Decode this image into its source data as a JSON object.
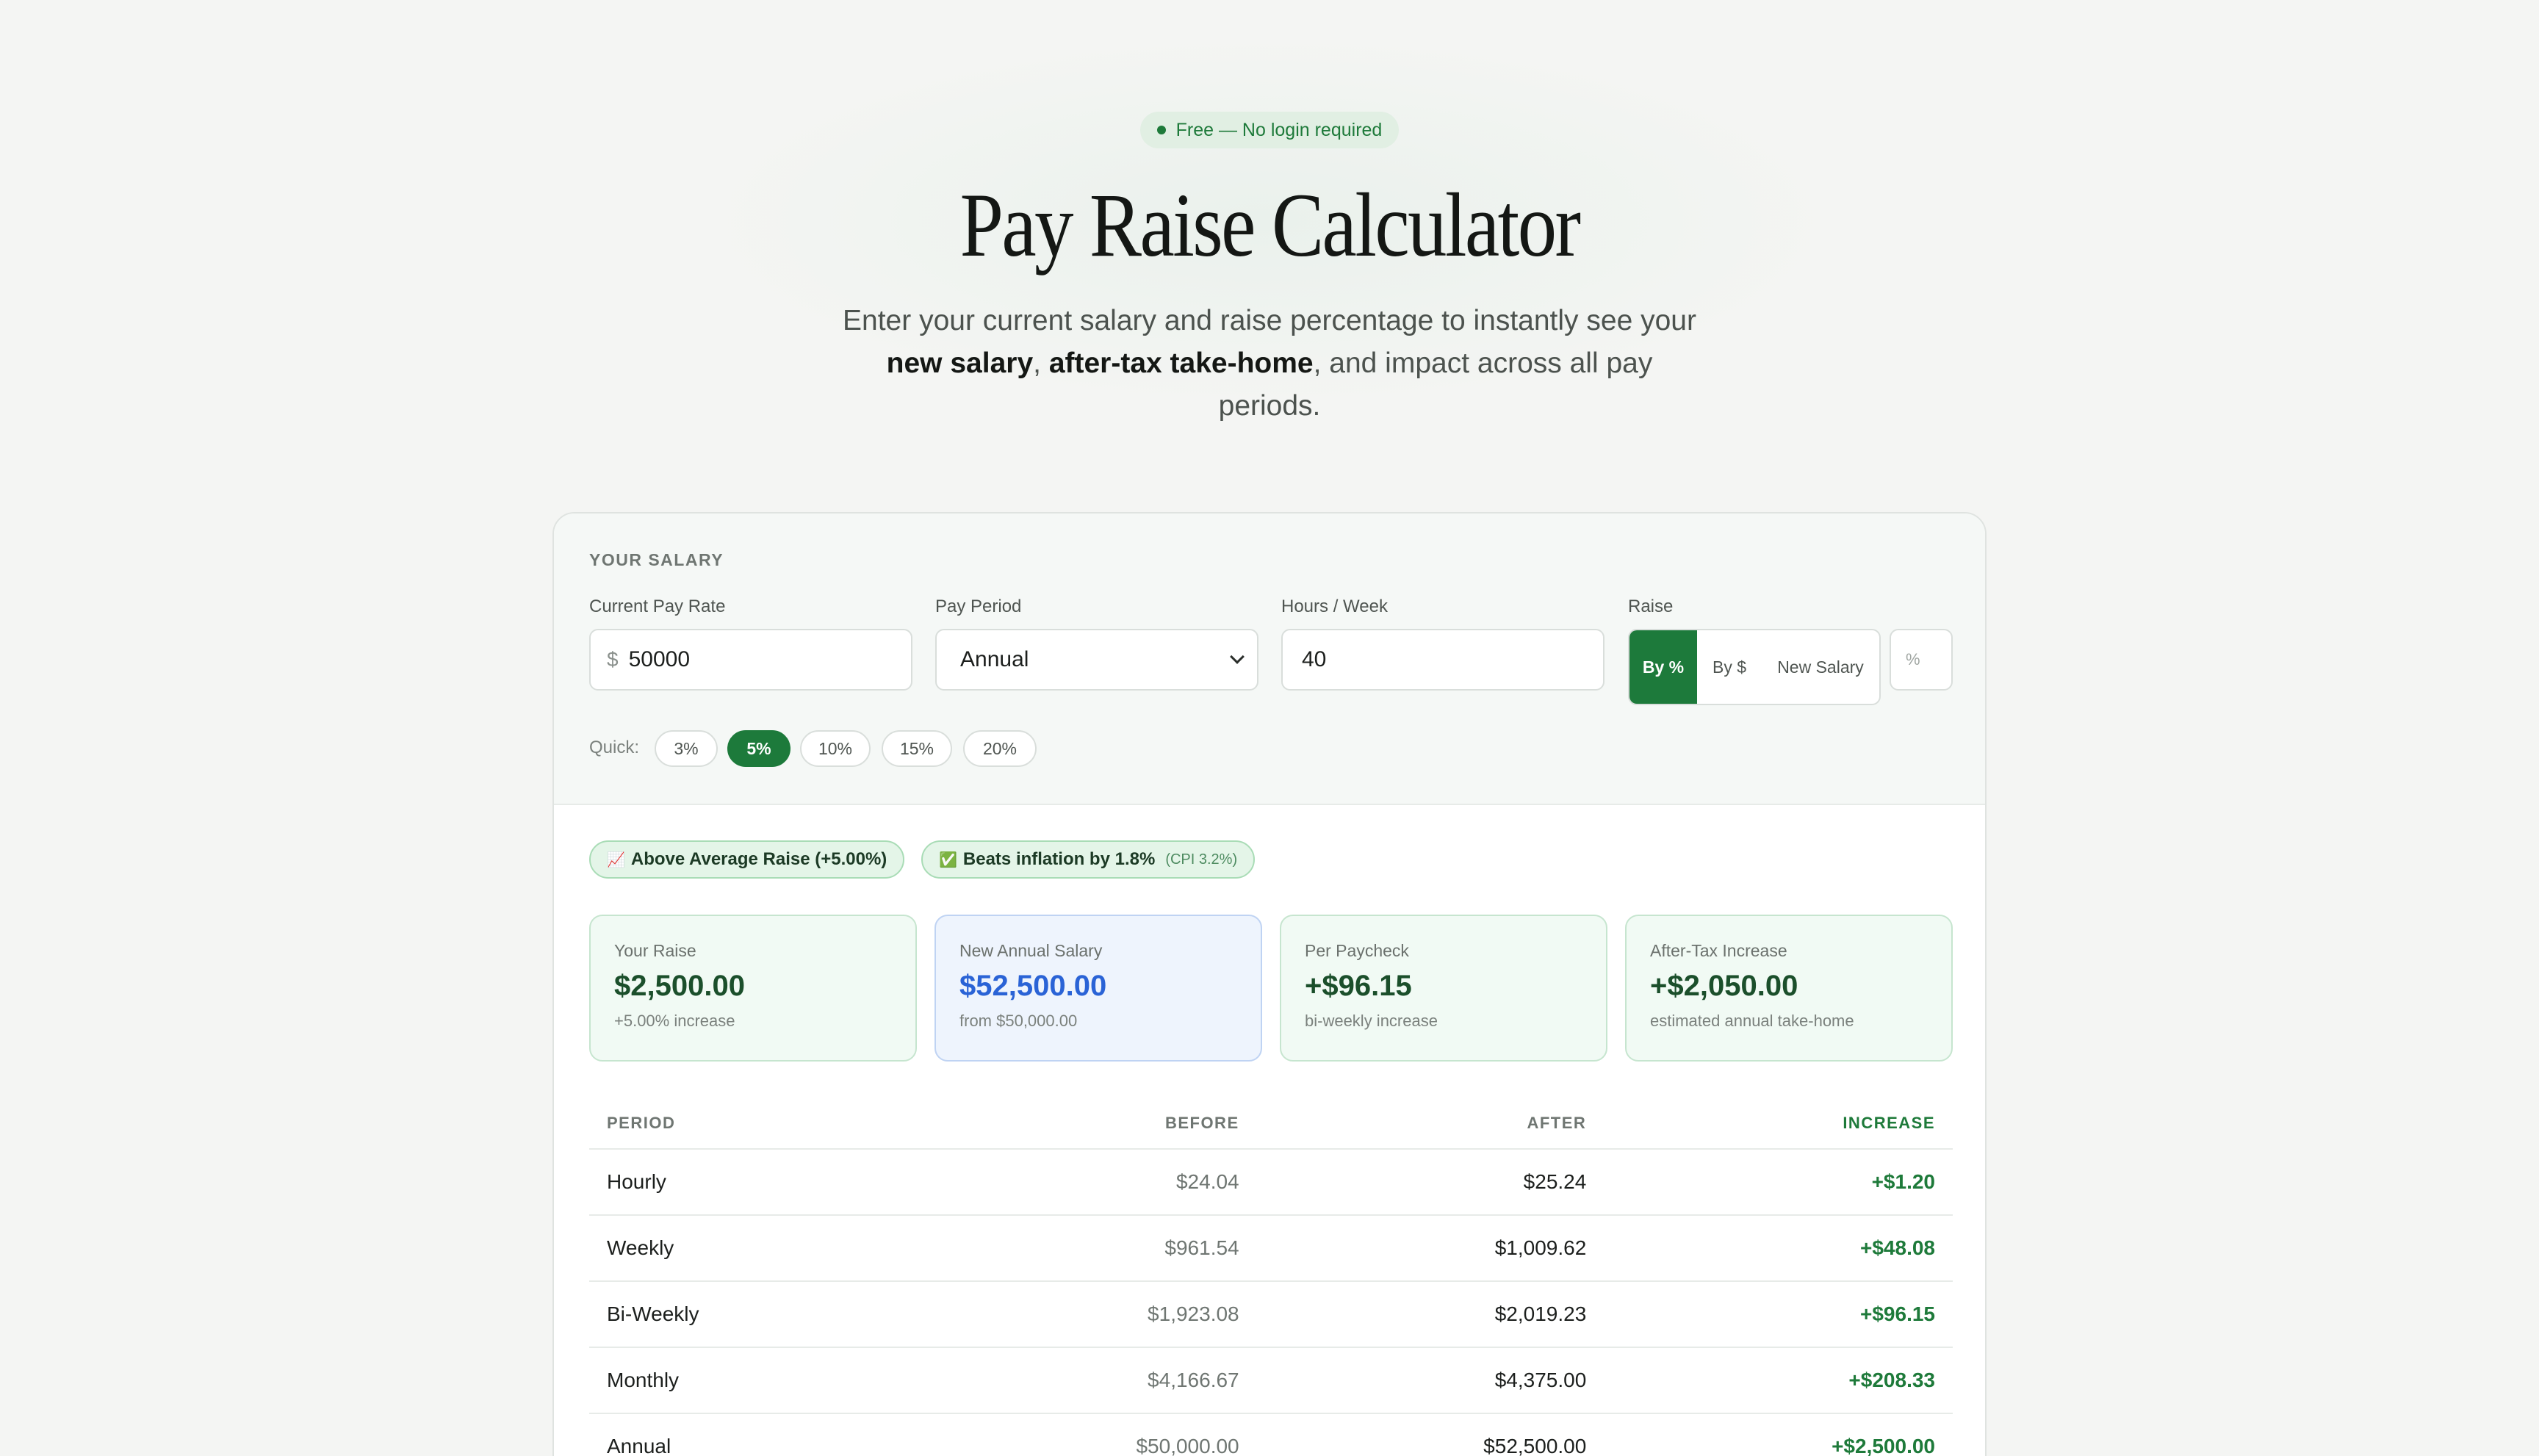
{
  "hero": {
    "badge": "Free — No login required",
    "title": "Pay Raise Calculator",
    "subtitle_part1": "Enter your current salary and raise percentage to instantly see your",
    "subtitle_bold1": "new salary",
    "subtitle_sep": ",",
    "subtitle_bold2": "after-tax take-home",
    "subtitle_part2": ", and impact across all pay periods."
  },
  "inputs": {
    "section_label": "YOUR SALARY",
    "pay_rate": {
      "label": "Current Pay Rate",
      "prefix": "$",
      "value": "50000"
    },
    "pay_period": {
      "label": "Pay Period",
      "value": "Annual"
    },
    "hours": {
      "label": "Hours / Week",
      "value": "40"
    },
    "raise": {
      "label": "Raise",
      "modes": [
        "By %",
        "By $",
        "New Salary"
      ],
      "selected_mode": "By %",
      "value_placeholder": "%"
    },
    "quick": {
      "label": "Quick:",
      "options": [
        "3%",
        "5%",
        "10%",
        "15%",
        "20%"
      ],
      "selected": "5%"
    }
  },
  "tags": {
    "above_average": {
      "icon": "chart-increasing-icon",
      "text": "Above Average Raise (+5.00%)"
    },
    "inflation": {
      "icon": "check-mark-icon",
      "text": "Beats inflation by 1.8%",
      "cpi": "(CPI 3.2%)"
    }
  },
  "stats": [
    {
      "label": "Your Raise",
      "amount": "$2,500.00",
      "note": "+5.00% increase"
    },
    {
      "label": "New Annual Salary",
      "amount": "$52,500.00",
      "note": "from $50,000.00"
    },
    {
      "label": "Per Paycheck",
      "amount": "+$96.15",
      "note": "bi-weekly increase"
    },
    {
      "label": "After-Tax Increase",
      "amount": "+$2,050.00",
      "note": "estimated annual take-home"
    }
  ],
  "table": {
    "headers": [
      "PERIOD",
      "BEFORE",
      "AFTER",
      "INCREASE"
    ],
    "rows": [
      [
        "Hourly",
        "$24.04",
        "$25.24",
        "+$1.20"
      ],
      [
        "Weekly",
        "$961.54",
        "$1,009.62",
        "+$48.08"
      ],
      [
        "Bi-Weekly",
        "$1,923.08",
        "$2,019.23",
        "+$96.15"
      ],
      [
        "Monthly",
        "$4,166.67",
        "$4,375.00",
        "+$208.33"
      ],
      [
        "Annual",
        "$50,000.00",
        "$52,500.00",
        "+$2,500.00"
      ]
    ]
  },
  "colors": {
    "accent": "#1d7a3b",
    "blue_amount": "#2a63d6",
    "increase_text": "#1e7a3a"
  }
}
